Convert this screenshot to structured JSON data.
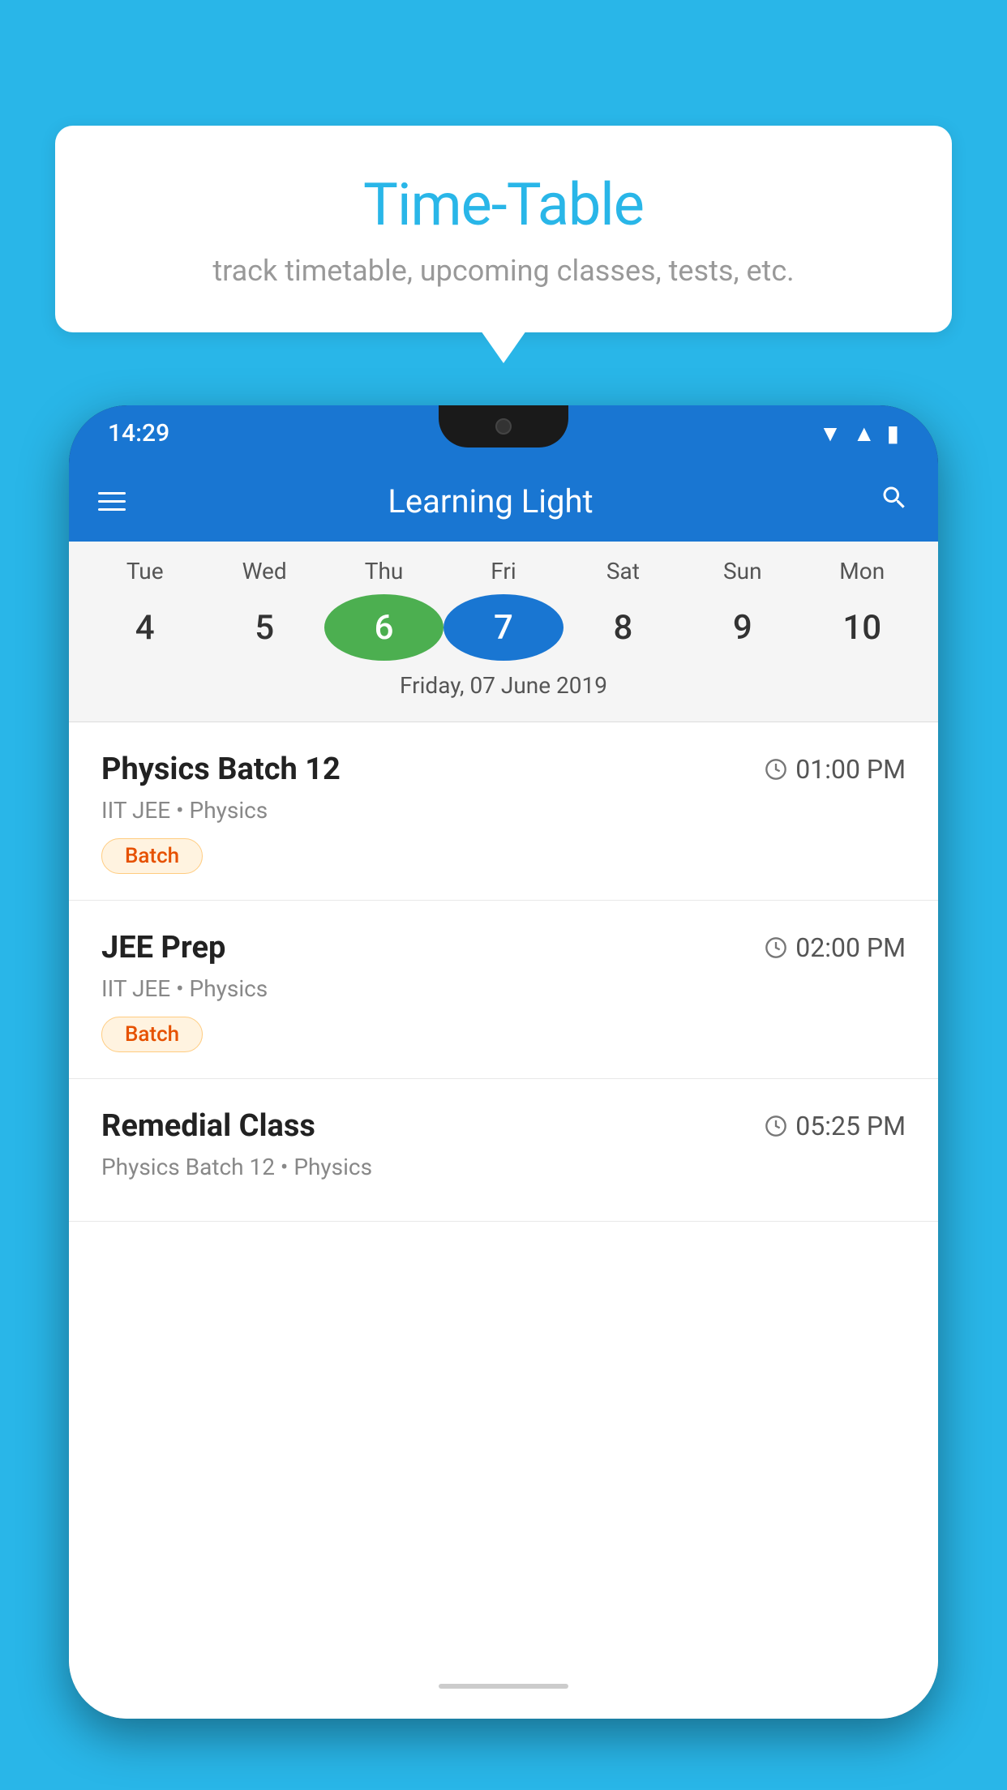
{
  "background_color": "#29b6e8",
  "speech_bubble": {
    "title": "Time-Table",
    "subtitle": "track timetable, upcoming classes, tests, etc."
  },
  "status_bar": {
    "time": "14:29",
    "icons": [
      "wifi",
      "signal",
      "battery"
    ]
  },
  "app_bar": {
    "title": "Learning Light",
    "menu_label": "menu",
    "search_label": "search"
  },
  "calendar": {
    "days_of_week": [
      "Tue",
      "Wed",
      "Thu",
      "Fri",
      "Sat",
      "Sun",
      "Mon"
    ],
    "dates": [
      "4",
      "5",
      "6",
      "7",
      "8",
      "9",
      "10"
    ],
    "today_index": 2,
    "selected_index": 3,
    "selected_date_label": "Friday, 07 June 2019"
  },
  "schedule_items": [
    {
      "title": "Physics Batch 12",
      "time": "01:00 PM",
      "meta": "IIT JEE • Physics",
      "badge": "Batch"
    },
    {
      "title": "JEE Prep",
      "time": "02:00 PM",
      "meta": "IIT JEE • Physics",
      "badge": "Batch"
    },
    {
      "title": "Remedial Class",
      "time": "05:25 PM",
      "meta": "Physics Batch 12 • Physics",
      "badge": null
    }
  ],
  "icons": {
    "menu": "☰",
    "search": "🔍",
    "clock": "🕐"
  }
}
